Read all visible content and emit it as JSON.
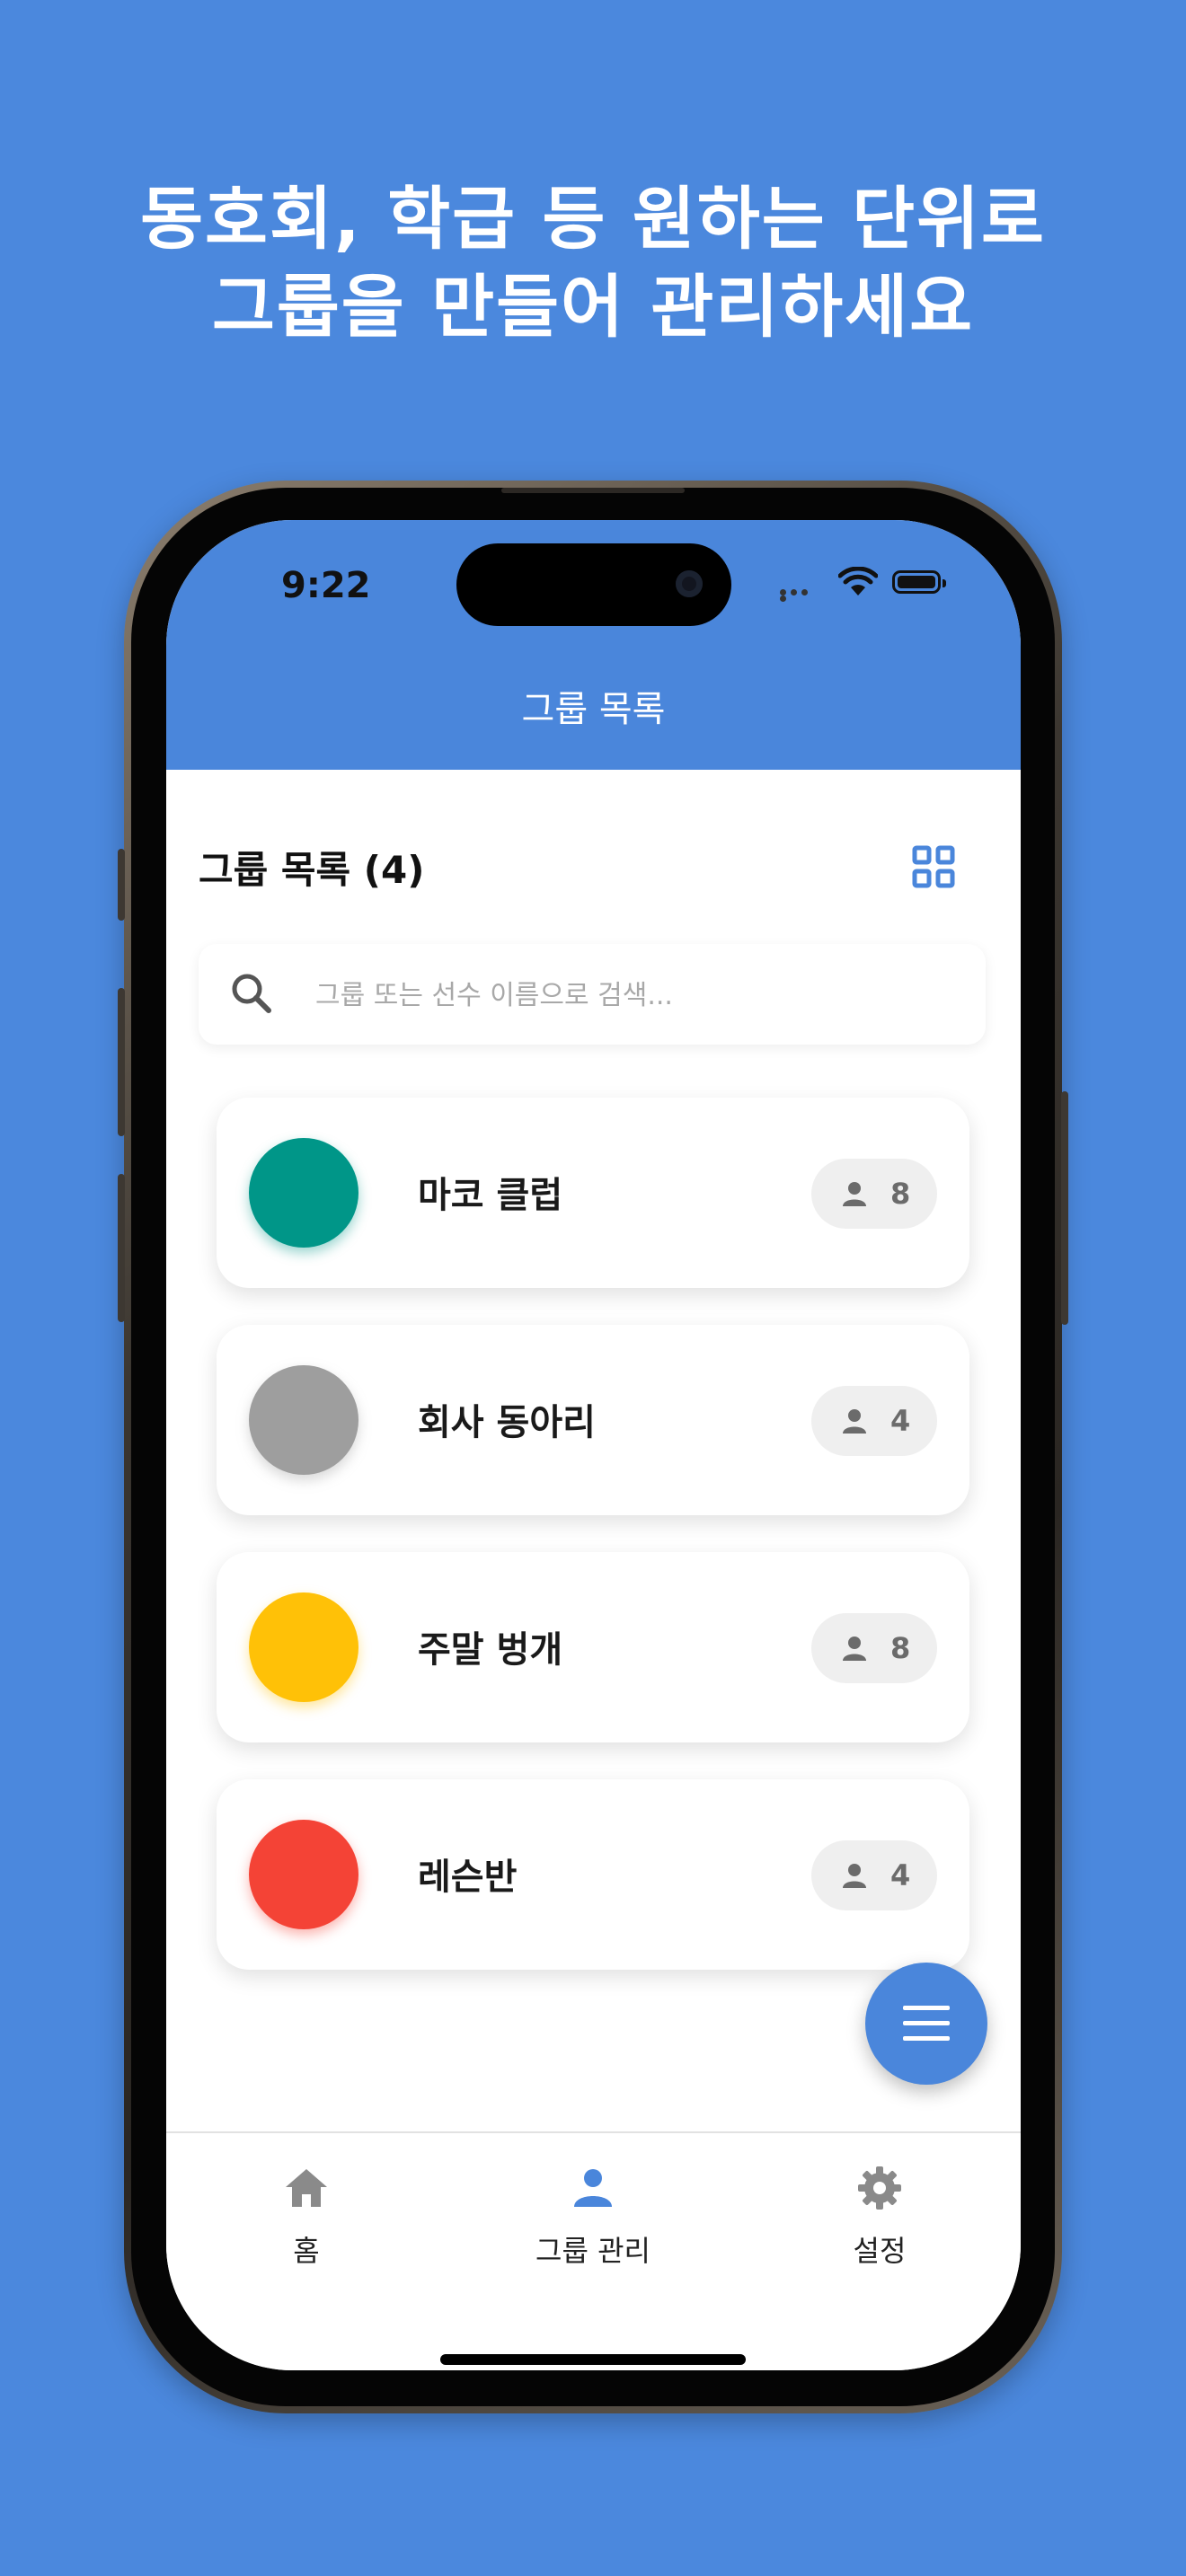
{
  "promo": {
    "line1": "동호회, 학급 등 원하는 단위로",
    "line2": "그룹을 만들어 관리하세요"
  },
  "status_bar": {
    "time": "9:22"
  },
  "app_bar": {
    "title": "그룹 목록"
  },
  "list_header": {
    "title": "그룹 목록 (4)"
  },
  "search": {
    "placeholder": "그룹 또는 선수 이름으로 검색..."
  },
  "groups": [
    {
      "name": "마코 클럽",
      "count": "8",
      "color": "#009688"
    },
    {
      "name": "회사 동아리",
      "count": "4",
      "color": "#9e9e9e"
    },
    {
      "name": "주말 벙개",
      "count": "8",
      "color": "#ffc107"
    },
    {
      "name": "레슨반",
      "count": "4",
      "color": "#f44336"
    }
  ],
  "tabs": [
    {
      "label": "홈",
      "icon": "home-icon",
      "active": false
    },
    {
      "label": "그룹 관리",
      "icon": "person-icon",
      "active": true
    },
    {
      "label": "설정",
      "icon": "gear-icon",
      "active": false
    }
  ],
  "colors": {
    "background": "#4b88dd",
    "primary": "#4a86db",
    "inactive_icon": "#8a8a8a"
  }
}
